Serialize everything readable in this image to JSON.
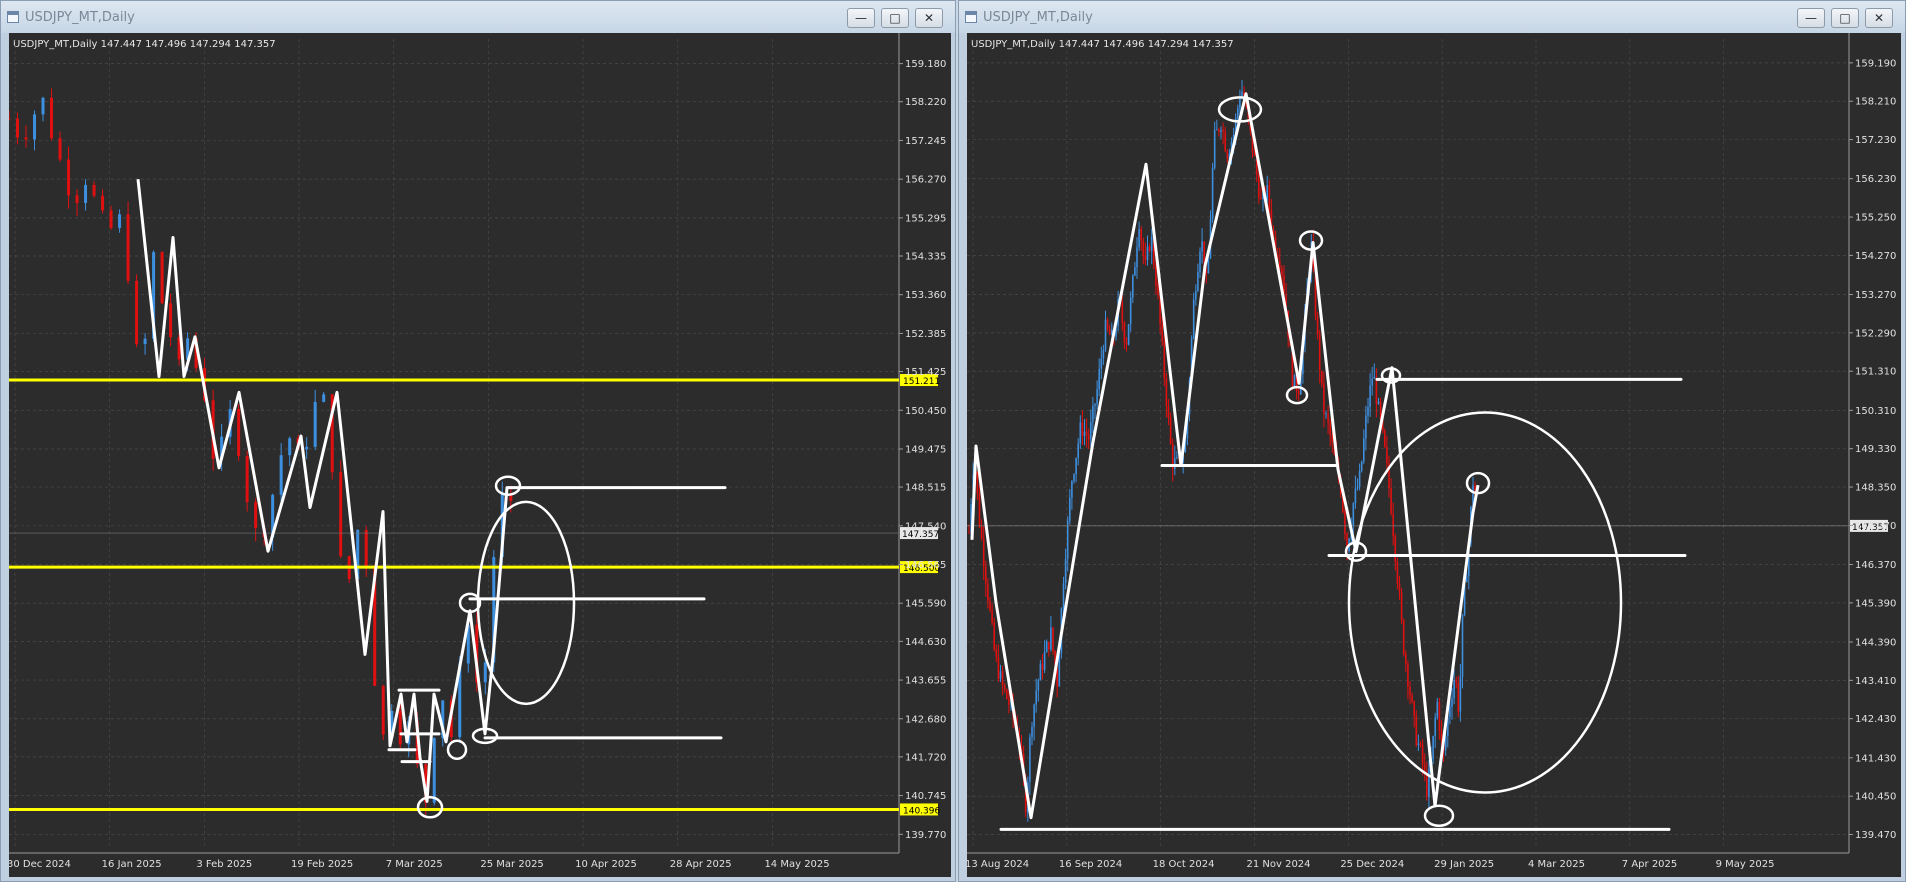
{
  "windows": [
    {
      "title": "USDJPY_MT,Daily",
      "buttons": {
        "minimize": "—",
        "maximize": "□",
        "close": "✕"
      },
      "header": "USDJPY_MT,Daily  147.447 147.496 147.294 147.357"
    },
    {
      "title": "USDJPY_MT,Daily",
      "buttons": {
        "minimize": "—",
        "maximize": "□",
        "close": "✕"
      },
      "header": "USDJPY_MT,Daily  147.447 147.496 147.294 147.357"
    }
  ],
  "colors": {
    "background": "#2c2c2c",
    "bull": "#3d8fe0",
    "bear": "#e01010",
    "level": "#ffff00",
    "drawing": "#ffffff",
    "grid": "#4a4a4a"
  },
  "chart_data": [
    {
      "type": "candlestick",
      "symbol": "USDJPY_MT",
      "timeframe": "Daily",
      "ylim": [
        139.4,
        159.8
      ],
      "yticks": [
        "159.180",
        "158.220",
        "157.245",
        "156.270",
        "155.295",
        "154.335",
        "153.360",
        "152.385",
        "151.425",
        "150.450",
        "149.475",
        "148.515",
        "147.540",
        "146.565",
        "145.590",
        "144.630",
        "143.655",
        "142.680",
        "141.720",
        "140.745",
        "139.770"
      ],
      "xticks": [
        "30 Dec 2024",
        "16 Jan 2025",
        "3 Feb 2025",
        "19 Feb 2025",
        "7 Mar 2025",
        "25 Mar 2025",
        "10 Apr 2025",
        "28 Apr 2025",
        "14 May 2025"
      ],
      "current_price": "147.357",
      "levels": [
        {
          "label": "151.211",
          "value": 151.211
        },
        {
          "label": "146.500",
          "value": 146.5
        },
        {
          "label": "140.396",
          "value": 140.396
        }
      ],
      "path": [
        [
          0,
          157.8
        ],
        [
          3,
          157.3
        ],
        [
          5,
          157.6
        ],
        [
          8,
          158.4
        ],
        [
          10,
          157.6
        ],
        [
          13,
          156.6
        ],
        [
          16,
          155.7
        ],
        [
          19,
          156.3
        ],
        [
          22,
          155.5
        ],
        [
          25,
          154.8
        ],
        [
          26,
          155.9
        ],
        [
          28,
          154.9
        ],
        [
          30,
          153.5
        ],
        [
          32,
          151.4
        ],
        [
          34,
          152.4
        ],
        [
          36,
          154.7
        ],
        [
          38,
          153.0
        ],
        [
          40,
          152.3
        ],
        [
          42,
          151.5
        ],
        [
          44,
          152.3
        ],
        [
          46,
          151.6
        ],
        [
          49,
          150.6
        ],
        [
          51,
          148.8
        ],
        [
          53,
          149.8
        ],
        [
          55,
          150.5
        ],
        [
          58,
          148.8
        ],
        [
          60,
          147.5
        ],
        [
          62,
          147.2
        ],
        [
          64,
          147.8
        ],
        [
          67,
          149.3
        ],
        [
          70,
          149.9
        ],
        [
          72,
          149.0
        ],
        [
          75,
          150.4
        ],
        [
          77,
          151.0
        ],
        [
          79,
          150.1
        ],
        [
          81,
          147.6
        ],
        [
          83,
          145.4
        ],
        [
          85,
          147.0
        ],
        [
          87,
          147.8
        ],
        [
          89,
          145.9
        ],
        [
          91,
          142.5
        ],
        [
          93,
          142.1
        ],
        [
          95,
          143.4
        ],
        [
          97,
          142.0
        ],
        [
          99,
          142.6
        ],
        [
          101,
          141.3
        ],
        [
          103,
          140.6
        ],
        [
          105,
          142.4
        ],
        [
          107,
          143.3
        ],
        [
          109,
          142.1
        ],
        [
          111,
          143.6
        ],
        [
          113,
          145.4
        ],
        [
          115,
          144.6
        ],
        [
          116,
          142.6
        ],
        [
          118,
          144.5
        ],
        [
          120,
          147.2
        ],
        [
          122,
          148.3
        ],
        [
          124,
          147.9
        ],
        [
          125,
          147.4
        ]
      ],
      "zigzag": [
        [
          129,
          156.27
        ],
        [
          150,
          151.3
        ],
        [
          164,
          154.8
        ],
        [
          175,
          151.3
        ],
        [
          186,
          152.3
        ],
        [
          210,
          149.0
        ],
        [
          230,
          150.9
        ],
        [
          259,
          146.9
        ],
        [
          292,
          149.8
        ],
        [
          301,
          148.0
        ],
        [
          328,
          150.9
        ],
        [
          356,
          144.3
        ],
        [
          374,
          147.9
        ],
        [
          381,
          142.0
        ],
        [
          392,
          143.3
        ],
        [
          398,
          142.1
        ],
        [
          405,
          143.3
        ],
        [
          411,
          141.7
        ],
        [
          418,
          140.6
        ],
        [
          425,
          143.3
        ],
        [
          437,
          142.1
        ],
        [
          461,
          145.4
        ],
        [
          476,
          142.3
        ],
        [
          485,
          144.5
        ],
        [
          498,
          148.5
        ]
      ],
      "h_lines": [
        [
          [
            498,
            148.5
          ],
          [
            716,
            148.5
          ]
        ],
        [
          [
            461,
            145.7
          ],
          [
            695,
            145.7
          ]
        ],
        [
          [
            476,
            142.2
          ],
          [
            712,
            142.2
          ]
        ],
        [
          [
            390,
            143.4
          ],
          [
            430,
            143.4
          ]
        ],
        [
          [
            392,
            142.3
          ],
          [
            430,
            142.3
          ]
        ],
        [
          [
            380,
            141.9
          ],
          [
            406,
            141.9
          ]
        ],
        [
          [
            393,
            141.6
          ],
          [
            421,
            141.6
          ]
        ]
      ],
      "circles": [
        [
          499,
          148.55,
          12,
          9
        ],
        [
          461,
          145.6,
          10,
          9
        ],
        [
          448,
          141.9,
          9,
          9
        ],
        [
          476,
          142.25,
          12,
          7
        ],
        [
          421,
          140.45,
          12,
          10
        ]
      ],
      "ellipse": [
        517,
        145.6,
        48,
        101
      ]
    },
    {
      "type": "candlestick",
      "symbol": "USDJPY_MT",
      "timeframe": "Daily",
      "ylim": [
        139.1,
        159.8
      ],
      "yticks": [
        "159.190",
        "158.210",
        "157.230",
        "156.230",
        "155.250",
        "154.270",
        "153.270",
        "152.290",
        "151.310",
        "150.310",
        "149.330",
        "148.350",
        "147.370",
        "146.370",
        "145.390",
        "144.390",
        "143.410",
        "142.430",
        "141.430",
        "140.450",
        "139.470"
      ],
      "xticks": [
        "13 Aug 2024",
        "16 Sep 2024",
        "18 Oct 2024",
        "21 Nov 2024",
        "25 Dec 2024",
        "29 Jan 2025",
        "4 Mar 2025",
        "7 Apr 2025",
        "9 May 2025"
      ],
      "current_price": "147.357",
      "path": [
        [
          0,
          147.2
        ],
        [
          5,
          149.2
        ],
        [
          10,
          147.6
        ],
        [
          18,
          145.8
        ],
        [
          26,
          144.0
        ],
        [
          34,
          143.2
        ],
        [
          42,
          142.7
        ],
        [
          50,
          141.9
        ],
        [
          57,
          140.2
        ],
        [
          62,
          142.3
        ],
        [
          68,
          143.3
        ],
        [
          75,
          144.0
        ],
        [
          82,
          144.6
        ],
        [
          88,
          143.3
        ],
        [
          95,
          146.3
        ],
        [
          103,
          148.6
        ],
        [
          112,
          149.9
        ],
        [
          120,
          149.6
        ],
        [
          128,
          150.8
        ],
        [
          136,
          152.4
        ],
        [
          144,
          152.1
        ],
        [
          150,
          153.1
        ],
        [
          157,
          152.0
        ],
        [
          164,
          153.6
        ],
        [
          170,
          155.2
        ],
        [
          176,
          153.9
        ],
        [
          182,
          154.8
        ],
        [
          188,
          153.4
        ],
        [
          196,
          151.0
        ],
        [
          203,
          149.0
        ],
        [
          210,
          148.9
        ],
        [
          217,
          149.6
        ],
        [
          225,
          153.2
        ],
        [
          232,
          154.8
        ],
        [
          238,
          153.4
        ],
        [
          245,
          157.2
        ],
        [
          252,
          157.7
        ],
        [
          258,
          156.9
        ],
        [
          265,
          157.4
        ],
        [
          272,
          158.6
        ],
        [
          279,
          157.7
        ],
        [
          285,
          156.8
        ],
        [
          292,
          155.6
        ],
        [
          298,
          155.9
        ],
        [
          305,
          154.6
        ],
        [
          312,
          154.1
        ],
        [
          318,
          152.7
        ],
        [
          324,
          151.0
        ],
        [
          330,
          150.9
        ],
        [
          336,
          152.7
        ],
        [
          342,
          154.6
        ],
        [
          348,
          152.3
        ],
        [
          354,
          150.4
        ],
        [
          360,
          149.8
        ],
        [
          366,
          149.0
        ],
        [
          372,
          148.3
        ],
        [
          378,
          146.8
        ],
        [
          384,
          147.9
        ],
        [
          391,
          148.6
        ],
        [
          398,
          150.3
        ],
        [
          404,
          151.3
        ],
        [
          410,
          150.2
        ],
        [
          416,
          149.2
        ],
        [
          422,
          147.9
        ],
        [
          428,
          146.2
        ],
        [
          434,
          144.4
        ],
        [
          440,
          143.3
        ],
        [
          446,
          142.1
        ],
        [
          452,
          141.5
        ],
        [
          458,
          140.6
        ],
        [
          462,
          141.3
        ],
        [
          468,
          142.9
        ],
        [
          474,
          141.4
        ],
        [
          480,
          142.7
        ],
        [
          486,
          143.6
        ],
        [
          490,
          142.6
        ],
        [
          494,
          145.2
        ],
        [
          500,
          147.0
        ],
        [
          504,
          148.5
        ],
        [
          508,
          147.4
        ]
      ],
      "zigzag": [
        [
          3,
          147.0
        ],
        [
          7,
          149.4
        ],
        [
          27,
          145.4
        ],
        [
          62,
          139.9
        ],
        [
          124,
          149.5
        ],
        [
          177,
          156.6
        ],
        [
          212,
          148.9
        ],
        [
          236,
          154.0
        ],
        [
          277,
          158.4
        ],
        [
          330,
          151.0
        ],
        [
          344,
          154.6
        ],
        [
          369,
          148.8
        ],
        [
          387,
          146.7
        ],
        [
          423,
          151.4
        ],
        [
          466,
          140.2
        ],
        [
          504,
          147.7
        ],
        [
          509,
          148.4
        ]
      ],
      "h_lines": [
        [
          [
            408,
            151.1
          ],
          [
            712,
            151.1
          ]
        ],
        [
          [
            360,
            146.6
          ],
          [
            716,
            146.6
          ]
        ],
        [
          [
            193,
            148.9
          ],
          [
            368,
            148.9
          ]
        ],
        [
          [
            32,
            139.6
          ],
          [
            700,
            139.6
          ]
        ]
      ],
      "circles": [
        [
          271,
          158.0,
          21,
          12
        ],
        [
          342,
          154.65,
          11,
          9
        ],
        [
          328,
          150.7,
          10,
          8
        ],
        [
          422,
          151.2,
          9,
          7
        ],
        [
          387,
          146.7,
          10,
          9
        ],
        [
          509,
          148.45,
          11,
          10
        ],
        [
          470,
          139.95,
          14,
          10
        ]
      ],
      "ellipse": [
        516,
        145.4,
        136,
        190
      ]
    }
  ]
}
